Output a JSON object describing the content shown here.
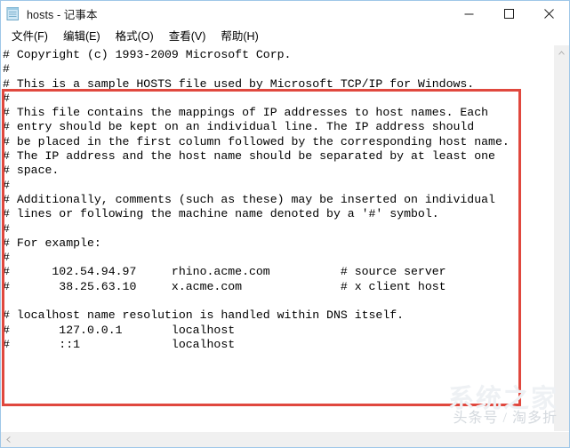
{
  "window": {
    "title": "hosts - 记事本",
    "icon": "notepad-icon",
    "border_color": "#9ec6e8",
    "controls": {
      "minimize": "minimize-icon",
      "maximize": "maximize-icon",
      "close": "close-icon"
    }
  },
  "menubar": {
    "items": [
      {
        "label": "文件(F)"
      },
      {
        "label": "编辑(E)"
      },
      {
        "label": "格式(O)"
      },
      {
        "label": "查看(V)"
      },
      {
        "label": "帮助(H)"
      }
    ]
  },
  "editor": {
    "content": "# Copyright (c) 1993-2009 Microsoft Corp.\n#\n# This is a sample HOSTS file used by Microsoft TCP/IP for Windows.\n#\n# This file contains the mappings of IP addresses to host names. Each\n# entry should be kept on an individual line. The IP address should\n# be placed in the first column followed by the corresponding host name.\n# The IP address and the host name should be separated by at least one\n# space.\n#\n# Additionally, comments (such as these) may be inserted on individual\n# lines or following the machine name denoted by a '#' symbol.\n#\n# For example:\n#\n#      102.54.94.97     rhino.acme.com          # source server\n#       38.25.63.10     x.acme.com              # x client host\n\n# localhost name resolution is handled within DNS itself.\n#       127.0.0.1       localhost\n#       ::1             localhost"
  },
  "annotation": {
    "red_box_color": "#e0483e"
  },
  "scrollbars": {
    "vertical": {
      "up_arrow": "chevron-up-icon",
      "down_arrow": "chevron-down-icon"
    },
    "horizontal": {
      "left_arrow": "chevron-left-icon",
      "right_arrow": "chevron-right-icon"
    }
  },
  "watermark": {
    "background": "系统之家",
    "foreground": "头条号 / 淘多折"
  }
}
